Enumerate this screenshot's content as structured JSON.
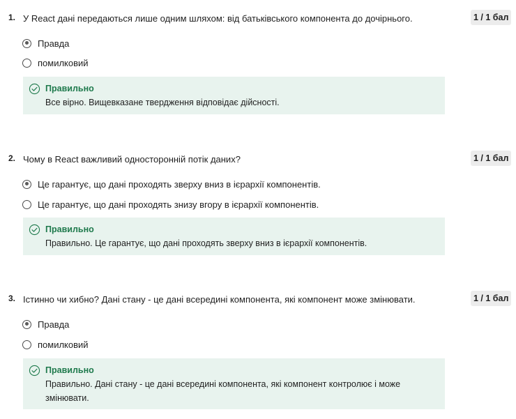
{
  "questions": [
    {
      "number": "1.",
      "text": "У React дані передаються лише одним шляхом: від батьківського компонента до дочірнього.",
      "score": "1 / 1 бал",
      "options": [
        {
          "label": "Правда",
          "selected": true
        },
        {
          "label": "помилковий",
          "selected": false
        }
      ],
      "feedback": {
        "title": "Правильно",
        "text": "Все вірно. Вищевказане твердження відповідає дійсності."
      }
    },
    {
      "number": "2.",
      "text": "Чому в React важливий односторонній потік даних?",
      "score": "1 / 1 бал",
      "options": [
        {
          "label": "Це гарантує, що дані проходять зверху вниз в ієрархії компонентів.",
          "selected": true
        },
        {
          "label": "Це гарантує, що дані проходять знизу вгору в ієрархії компонентів.",
          "selected": false
        }
      ],
      "feedback": {
        "title": "Правильно",
        "text": "Правильно. Це гарантує, що дані проходять зверху вниз в ієрархії компонентів."
      }
    },
    {
      "number": "3.",
      "text": "Істинно чи хибно? Дані стану - це дані всередині компонента, які компонент може змінювати.",
      "score": "1 / 1 бал",
      "options": [
        {
          "label": "Правда",
          "selected": true
        },
        {
          "label": "помилковий",
          "selected": false
        }
      ],
      "feedback": {
        "title": "Правильно",
        "text": "Правильно. Дані стану - це дані всередині компонента, які компонент контролює і може змінювати."
      }
    }
  ],
  "colors": {
    "feedback_bg": "#e8f3ee",
    "correct_green": "#1f7a4d",
    "score_bg": "#ececec"
  },
  "icons": {
    "feedback": "check-circle-icon"
  }
}
